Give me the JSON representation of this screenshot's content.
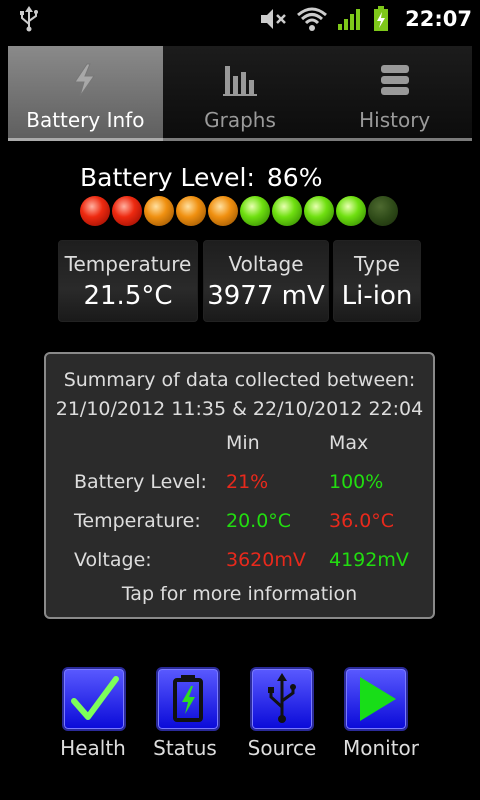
{
  "status_bar": {
    "time": "22:07",
    "icons": [
      "usb-icon",
      "mute-icon",
      "wifi-icon",
      "signal-icon",
      "battery-charging-icon"
    ]
  },
  "tabs": [
    {
      "label": "Battery Info",
      "icon": "lightning-icon",
      "active": true
    },
    {
      "label": "Graphs",
      "icon": "bar-graph-icon",
      "active": false
    },
    {
      "label": "History",
      "icon": "list-icon",
      "active": false
    }
  ],
  "battery": {
    "level_label": "Battery Level:",
    "level_value": "86%",
    "leds": [
      "red",
      "red",
      "orange",
      "orange",
      "orange",
      "green",
      "green",
      "green",
      "green",
      "off"
    ]
  },
  "info": {
    "temperature": {
      "title": "Temperature",
      "value": "21.5°C"
    },
    "voltage": {
      "title": "Voltage",
      "value": "3977 mV"
    },
    "type": {
      "title": "Type",
      "value": "Li-ion"
    }
  },
  "summary": {
    "line1": "Summary of data collected between:",
    "line2": "21/10/2012 11:35 & 22/10/2012 22:04",
    "min_header": "Min",
    "max_header": "Max",
    "rows": [
      {
        "label": "Battery Level:",
        "min": "21%",
        "max": "100%"
      },
      {
        "label": "Temperature:",
        "min": "20.0°C",
        "max": "36.0°C"
      },
      {
        "label": "Voltage:",
        "min": "3620mV",
        "max": "4192mV"
      }
    ],
    "footer": "Tap for more information"
  },
  "actions": [
    {
      "label": "Health",
      "icon": "checkmark-icon"
    },
    {
      "label": "Status",
      "icon": "battery-icon"
    },
    {
      "label": "Source",
      "icon": "usb-icon"
    },
    {
      "label": "Monitor",
      "icon": "play-icon"
    }
  ],
  "colors": {
    "min_bad": "#e8291c",
    "good": "#22dd10",
    "button_blue": "#1a1aee"
  }
}
